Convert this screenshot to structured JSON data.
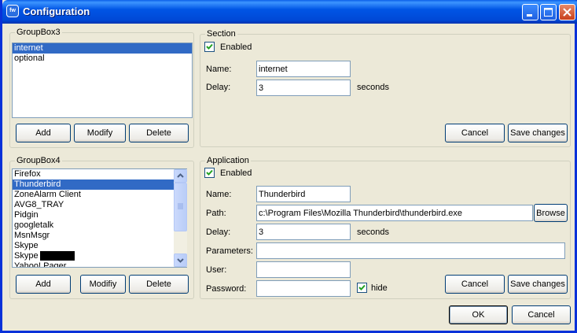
{
  "window": {
    "title": "Configuration",
    "icon": "app-icon"
  },
  "groupbox3": {
    "title": "GroupBox3",
    "items": [
      {
        "label": "internet",
        "selected": true
      },
      {
        "label": "optional",
        "selected": false
      }
    ],
    "buttons": {
      "add": "Add",
      "modify": "Modify",
      "delete": "Delete"
    }
  },
  "section": {
    "title": "Section",
    "enabled_label": "Enabled",
    "enabled": true,
    "name_label": "Name:",
    "name_value": "internet",
    "delay_label": "Delay:",
    "delay_value": "3",
    "seconds_label": "seconds",
    "cancel": "Cancel",
    "save": "Save changes"
  },
  "groupbox4": {
    "title": "GroupBox4",
    "items": [
      {
        "label": "Firefox",
        "selected": false
      },
      {
        "label": "Thunderbird",
        "selected": true
      },
      {
        "label": "ZoneAlarm Client",
        "selected": false
      },
      {
        "label": "AVG8_TRAY",
        "selected": false
      },
      {
        "label": "Pidgin",
        "selected": false
      },
      {
        "label": "googletalk",
        "selected": false
      },
      {
        "label": "MsnMsgr",
        "selected": false
      },
      {
        "label": "Skype",
        "selected": false
      },
      {
        "label": "Skype",
        "selected": false,
        "redacted": true
      },
      {
        "label": "Yahoo! Pager",
        "selected": false
      }
    ],
    "buttons": {
      "add": "Add",
      "modify": "Modifiy",
      "delete": "Delete"
    }
  },
  "application": {
    "title": "Application",
    "enabled_label": "Enabled",
    "enabled": true,
    "name_label": "Name:",
    "name_value": "Thunderbird",
    "path_label": "Path:",
    "path_value": "c:\\Program Files\\Mozilla Thunderbird\\thunderbird.exe",
    "browse": "Browse",
    "delay_label": "Delay:",
    "delay_value": "3",
    "seconds_label": "seconds",
    "parameters_label": "Parameters:",
    "parameters_value": "",
    "user_label": "User:",
    "user_value": "",
    "password_label": "Password:",
    "password_value": "",
    "hide_label": "hide",
    "hide": true,
    "cancel": "Cancel",
    "save": "Save changes"
  },
  "footer": {
    "ok": "OK",
    "cancel": "Cancel"
  }
}
